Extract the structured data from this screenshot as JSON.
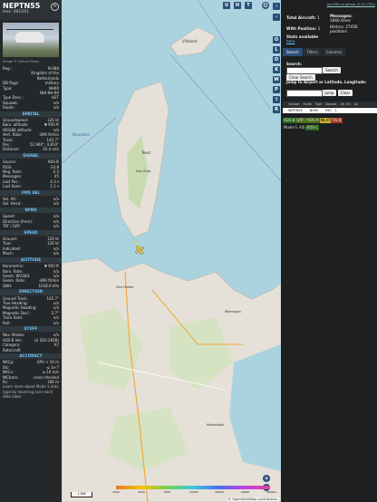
{
  "aircraft": {
    "callsign": "NEPTN55",
    "hex_label": "Hex: 481041",
    "image_credit": "Image © Callum Dixon",
    "registration_rows": [
      {
        "k": "Reg.:",
        "v": "N-088"
      },
      {
        "k": "",
        "v": "Kingdom of the"
      },
      {
        "k": "",
        "v": "Netherlands"
      },
      {
        "k": "DB flags:",
        "v": "military"
      },
      {
        "k": "Type:",
        "v": "NH90"
      },
      {
        "k": "",
        "v": "NHI NH-90"
      },
      {
        "k": "Type Desc.:",
        "v": "H2T"
      },
      {
        "k": "Squawk:",
        "v": "n/a"
      },
      {
        "k": "Route:",
        "v": "n/a"
      }
    ]
  },
  "sections": [
    {
      "title": "SPATIAL",
      "rows": [
        {
          "k": "Groundspeed:",
          "v": "126 kt"
        },
        {
          "k": "Baro. altitude:",
          "v": "▼ 950 ft"
        },
        {
          "k": "WGS84 altitude:",
          "v": "n/a"
        },
        {
          "k": "Vert. Rate:",
          "v": "-896 ft/min"
        },
        {
          "k": "Track:",
          "v": "145.7°"
        },
        {
          "k": "Pos.:",
          "v": "52.960°, 4.810°"
        },
        {
          "k": "Distance:",
          "v": "42.4 nmi"
        }
      ]
    },
    {
      "title": "SIGNAL",
      "rows": [
        {
          "k": "Source:",
          "v": "ADS-B"
        },
        {
          "k": "RSSI:",
          "v": "-24.8"
        },
        {
          "k": "Msg. Rate:",
          "v": "0.5"
        },
        {
          "k": "Messages:",
          "v": "45"
        },
        {
          "k": "Last Pos.:",
          "v": "4.3 s"
        },
        {
          "k": "Last Seen:",
          "v": "1.1 s"
        }
      ]
    },
    {
      "title": "FMS SEL",
      "rows": [
        {
          "k": "Sel. Alt.:",
          "v": "n/a"
        },
        {
          "k": "Sel. Head.:",
          "v": "n/a"
        }
      ]
    },
    {
      "title": "WIND",
      "rows": [
        {
          "k": "Speed:",
          "v": "n/a"
        },
        {
          "k": "Direction (from):",
          "v": "n/a"
        },
        {
          "k": "TAT / OAT:",
          "v": "n/a"
        }
      ]
    },
    {
      "title": "SPEED",
      "rows": [
        {
          "k": "Ground:",
          "v": "126 kt"
        },
        {
          "k": "True:",
          "v": "126 kt"
        },
        {
          "k": "Indicated:",
          "v": "n/a"
        },
        {
          "k": "Mach:",
          "v": "n/a"
        }
      ]
    },
    {
      "title": "ALTITUDE",
      "rows": [
        {
          "k": "Barometric:",
          "v": "▼ 950 ft"
        },
        {
          "k": "Baro. Rate:",
          "v": "n/a"
        },
        {
          "k": "Geom. WGS84:",
          "v": "n/a"
        },
        {
          "k": "Geom. Rate:",
          "v": "-896 ft/min"
        },
        {
          "k": "QNH:",
          "v": "1018.0 hPa"
        }
      ]
    },
    {
      "title": "DIRECTION",
      "rows": [
        {
          "k": "Ground Track:",
          "v": "145.7°"
        },
        {
          "k": "True Heading:",
          "v": "n/a"
        },
        {
          "k": "Magnetic Heading:",
          "v": "n/a"
        },
        {
          "k": "Magnetic Decl.:",
          "v": "2.7°"
        },
        {
          "k": "Track Rate:",
          "v": "n/a"
        },
        {
          "k": "Roll:",
          "v": "n/a"
        }
      ]
    },
    {
      "title": "STUFF",
      "rows": [
        {
          "k": "Nav. Modes:",
          "v": "n/a"
        },
        {
          "k": "ADS-B Ver.:",
          "v": "v2 (DO-260B)"
        },
        {
          "k": "Category:",
          "v": "A7"
        },
        {
          "k": "Rotorcraft",
          "v": ""
        }
      ]
    },
    {
      "title": "ACCURACY",
      "rows": [
        {
          "k": "NACp:",
          "v": "EPU < 10 m"
        },
        {
          "k": "SIL:",
          "v": "≤ 1e-7"
        },
        {
          "k": "NACv:",
          "v": "≤ 10 m/s"
        },
        {
          "k": "NICbaro:",
          "v": "cross-checked"
        },
        {
          "k": "Rc:",
          "v": "186 m"
        }
      ]
    }
  ],
  "learn_more": "Learn more about Mode S data type by hovering over each data label.",
  "map": {
    "labels": {
      "noordzee": "Noordzee",
      "vlieland": "Vlieland",
      "texel": "Texel",
      "den_burg": "Den Burg",
      "den_helder": "Den Helder",
      "wieringen": "Wieringen",
      "medemblik": "Medemblik"
    },
    "top_buttons": [
      "U",
      "H",
      "T"
    ],
    "right_buttons": [
      "O",
      "L",
      "O",
      "K",
      "W",
      "P",
      "I",
      "R"
    ],
    "scale_label": "1 NM",
    "alt_ticks": [
      "2000",
      "4000",
      "6000",
      "10000",
      "20000",
      "30000",
      "40000+"
    ],
    "attribution": "© OpenStreetMap contributors."
  },
  "stats": {
    "top_link": "tar1090 on github (3.14.1701)",
    "total_label": "Total Aircraft:",
    "total_value": "1",
    "position_label": "With Position:",
    "position_value": "1",
    "stats_label": "Stats available",
    "stats_link": "here",
    "messages_label": "Messages:",
    "messages_value": "1660.0/sec",
    "history_label": "History: 27456 positions"
  },
  "tabs": [
    "Search",
    "Filters",
    "Columns"
  ],
  "search": {
    "label": "Search:",
    "button": "Search",
    "clear": "Clear Search",
    "jump_label": "Jump to Airport or Latitude, Longitude:",
    "jump_button": "Jump",
    "clear_jump": "Clear"
  },
  "table": {
    "columns": [
      "",
      "Callsign",
      "Route",
      "Type",
      "Squawk",
      "Alt. (ft)",
      "Sp"
    ],
    "row": [
      "",
      "NEPTN55",
      "",
      "NH90",
      "",
      "950",
      "1"
    ]
  },
  "chips": [
    {
      "label": "ADS-B",
      "bg": "#2e6a1e",
      "fg": "#ddd"
    },
    {
      "label": "UAT / ADS-R",
      "bg": "#4a6b1a",
      "fg": "#ddd"
    },
    {
      "label": "MLAT",
      "bg": "#c9b03a",
      "fg": "#111"
    },
    {
      "label": "TIS-B",
      "bg": "#a83a2a",
      "fg": "#ddd"
    },
    {
      "label": "Mode-S",
      "bg": "#1d1f20",
      "fg": "#ddd"
    },
    {
      "label": "AIS",
      "bg": "#1d1f20",
      "fg": "#ddd"
    },
    {
      "label": "ADS-C",
      "bg": "#2e6a1e",
      "fg": "#ddd"
    }
  ],
  "colors": {
    "accent": "#6ec6ff",
    "button": "#2a4e78",
    "water": "#aad3df",
    "land": "#e5e0d8",
    "aircraft": "#f3d34c"
  }
}
